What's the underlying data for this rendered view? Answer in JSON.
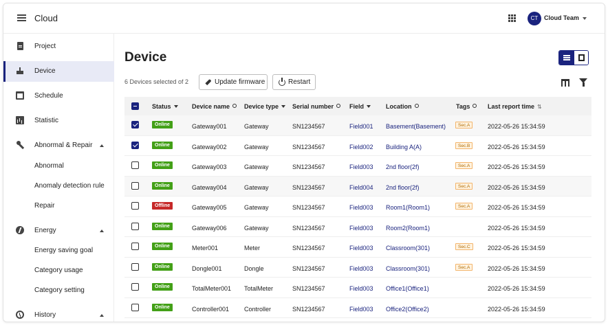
{
  "header": {
    "brand": "Cloud",
    "avatar_initials": "CT",
    "team_name": "Cloud Team"
  },
  "sidebar": {
    "items": [
      {
        "label": "Project",
        "icon": "document-icon"
      },
      {
        "label": "Device",
        "icon": "router-icon",
        "active": true
      },
      {
        "label": "Schedule",
        "icon": "calendar-icon"
      },
      {
        "label": "Statistic",
        "icon": "bar-chart-icon"
      },
      {
        "label": "Abnormal & Repair",
        "icon": "wrench-icon",
        "expanded": true
      },
      {
        "label": "Abnormal"
      },
      {
        "label": "Anomaly detection rule"
      },
      {
        "label": "Repair"
      },
      {
        "label": "Energy",
        "icon": "energy-icon",
        "expanded": true
      },
      {
        "label": "Energy saving goal"
      },
      {
        "label": "Category usage"
      },
      {
        "label": "Category setting"
      },
      {
        "label": "History",
        "icon": "history-icon",
        "expanded": true
      }
    ]
  },
  "main": {
    "title": "Device",
    "selection_text": "6 Devices selected of 2",
    "update_button": "Update firmware",
    "restart_button": "Restart"
  },
  "table": {
    "headers": {
      "status": "Status",
      "device_name": "Device name",
      "device_type": "Device type",
      "serial": "Serial number",
      "field": "Field",
      "location": "Location",
      "tags": "Tags",
      "last_report": "Last report time"
    },
    "rows": [
      {
        "checked": true,
        "status": "Online",
        "name": "Gateway001",
        "type": "Gateway",
        "serial": "SN1234567",
        "field": "Field001",
        "location": "Basement(Basement)",
        "tag": "Sec.A",
        "time": "2022-05-26 15:34:59"
      },
      {
        "checked": true,
        "status": "Online",
        "name": "Gateway002",
        "type": "Gateway",
        "serial": "SN1234567",
        "field": "Field002",
        "location": "Building A(A)",
        "tag": "Sec.B",
        "time": "2022-05-26 15:34:59"
      },
      {
        "checked": false,
        "status": "Online",
        "name": "Gateway003",
        "type": "Gateway",
        "serial": "SN1234567",
        "field": "Field003",
        "location": "2nd floor(2f)",
        "tag": "Sec.A",
        "time": "2022-05-26 15:34:59"
      },
      {
        "checked": false,
        "status": "Online",
        "name": "Gateway004",
        "type": "Gateway",
        "serial": "SN1234567",
        "field": "Field004",
        "location": "2nd floor(2f)",
        "tag": "Sec.A",
        "time": "2022-05-26 15:34:59"
      },
      {
        "checked": false,
        "status": "Offline",
        "name": "Gateway005",
        "type": "Gateway",
        "serial": "SN1234567",
        "field": "Field003",
        "location": "Room1(Room1)",
        "tag": "Sec.A",
        "time": "2022-05-26 15:34:59"
      },
      {
        "checked": false,
        "status": "Online",
        "name": "Gateway006",
        "type": "Gateway",
        "serial": "SN1234567",
        "field": "Field003",
        "location": "Room2(Room1)",
        "tag": "",
        "time": "2022-05-26 15:34:59"
      },
      {
        "checked": false,
        "status": "Online",
        "name": "Meter001",
        "type": "Meter",
        "serial": "SN1234567",
        "field": "Field003",
        "location": "Classroom(301)",
        "tag": "Sec.C",
        "time": "2022-05-26 15:34:59"
      },
      {
        "checked": false,
        "status": "Online",
        "name": "Dongle001",
        "type": "Dongle",
        "serial": "SN1234567",
        "field": "Field003",
        "location": "Classroom(301)",
        "tag": "Sec.A",
        "time": "2022-05-26 15:34:59"
      },
      {
        "checked": false,
        "status": "Online",
        "name": "TotalMeter001",
        "type": "TotalMeter",
        "serial": "SN1234567",
        "field": "Field003",
        "location": "Office1(Office1)",
        "tag": "",
        "time": "2022-05-26 15:34:59"
      },
      {
        "checked": false,
        "status": "Online",
        "name": "Controller001",
        "type": "Controller",
        "serial": "SN1234567",
        "field": "Field003",
        "location": "Office2(Office2)",
        "tag": "",
        "time": "2022-05-26 15:34:59"
      }
    ]
  },
  "colors": {
    "primary": "#1a237e",
    "online": "#43a017",
    "offline": "#c62828",
    "tag_text": "#b06a00"
  }
}
